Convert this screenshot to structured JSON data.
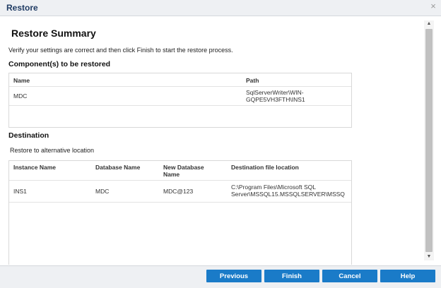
{
  "window": {
    "title": "Restore",
    "close_icon": "×"
  },
  "summary": {
    "heading": "Restore Summary",
    "instruction": "Verify your settings are correct and then click Finish to start the restore process."
  },
  "components": {
    "heading": "Component(s) to be restored",
    "columns": [
      "Name",
      "Path"
    ],
    "rows": [
      {
        "name": "MDC",
        "path_line1": "SqlServerWriter\\WIN-",
        "path_line2": "GQPE5VH3FTH\\INS1"
      }
    ]
  },
  "destination": {
    "heading": "Destination",
    "type": "Restore to alternative location",
    "columns": [
      "Instance Name",
      "Database Name",
      "New Database",
      "Name",
      "Destination file location"
    ],
    "rows": [
      {
        "instance": "INS1",
        "database": "MDC",
        "new_database": "MDC@123",
        "location_line1": "C:\\Program Files\\Microsoft SQL",
        "location_line2": "Server\\MSSQL15.MSSQLSERVER\\MSSQ"
      }
    ]
  },
  "scrollbar": {
    "up_icon": "▲",
    "down_icon": "▼"
  },
  "buttons": {
    "previous": "Previous",
    "finish": "Finish",
    "cancel": "Cancel",
    "help": "Help"
  },
  "colors": {
    "button_bg": "#1a7bc8",
    "title_text": "#1f3b63",
    "titlebar_bg": "#eef0f3"
  }
}
